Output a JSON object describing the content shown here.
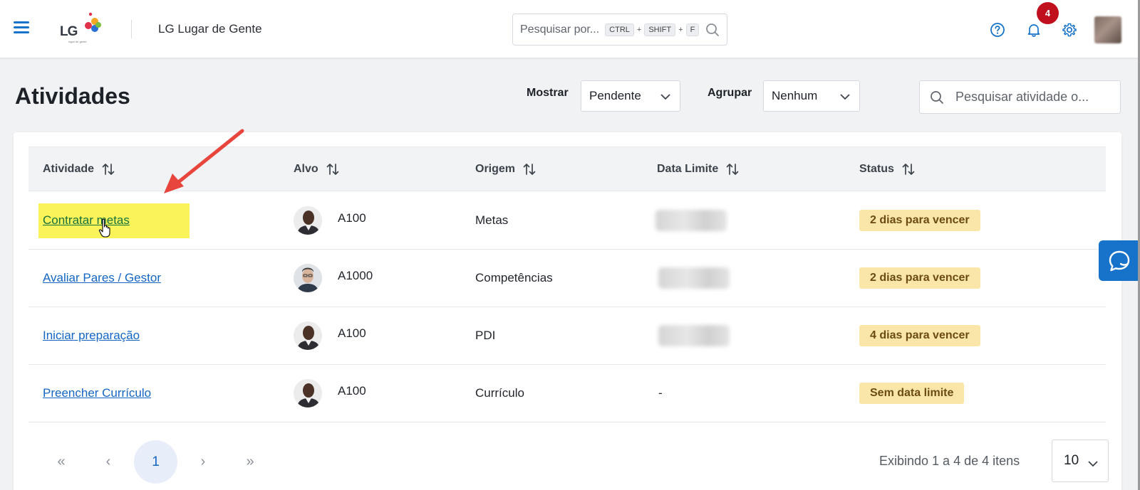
{
  "header": {
    "app_title": "LG Lugar de Gente",
    "logo_text": "LG",
    "logo_subtext": "lugar de gente",
    "search_placeholder": "Pesquisar por...",
    "shortcut_keys": [
      "CTRL",
      "SHIFT",
      "F"
    ],
    "shortcut_separator": "+",
    "notification_count": "4"
  },
  "page": {
    "title": "Atividades",
    "show_label": "Mostrar",
    "show_value": "Pendente",
    "group_label": "Agrupar",
    "group_value": "Nenhum",
    "activity_search_placeholder": "Pesquisar atividade o..."
  },
  "table": {
    "columns": [
      "Atividade",
      "Alvo",
      "Origem",
      "Data Limite",
      "Status"
    ],
    "rows": [
      {
        "activity": "Contratar metas",
        "target": "A100",
        "origin": "Metas",
        "deadline": "",
        "status": "2 dias para vencer",
        "highlighted": true
      },
      {
        "activity": "Avaliar Pares / Gestor",
        "target": "A1000",
        "origin": "Competências",
        "deadline": "",
        "status": "2 dias para vencer",
        "highlighted": false
      },
      {
        "activity": "Iniciar preparação",
        "target": "A100",
        "origin": "PDI",
        "deadline": "",
        "status": "4 dias para vencer",
        "highlighted": false
      },
      {
        "activity": "Preencher Currículo",
        "target": "A100",
        "origin": "Currículo",
        "deadline": "-",
        "status": "Sem data limite",
        "highlighted": false
      }
    ]
  },
  "pagination": {
    "first": "«",
    "prev": "‹",
    "current_page": "1",
    "next": "›",
    "last": "»",
    "info": "Exibindo 1 a 4 de 4 itens",
    "page_size": "10"
  },
  "colors": {
    "brand_blue": "#1773c9",
    "link": "#1366c4",
    "highlight": "#fbf35a",
    "status_badge_bg": "#fbe6aa",
    "notification_red": "#c0101e",
    "arrow_red": "#e8453c"
  },
  "icons": [
    "menu-icon",
    "help-icon",
    "bell-icon",
    "gear-icon",
    "search-icon",
    "sort-icon",
    "chevron-down-icon",
    "chat-icon"
  ]
}
